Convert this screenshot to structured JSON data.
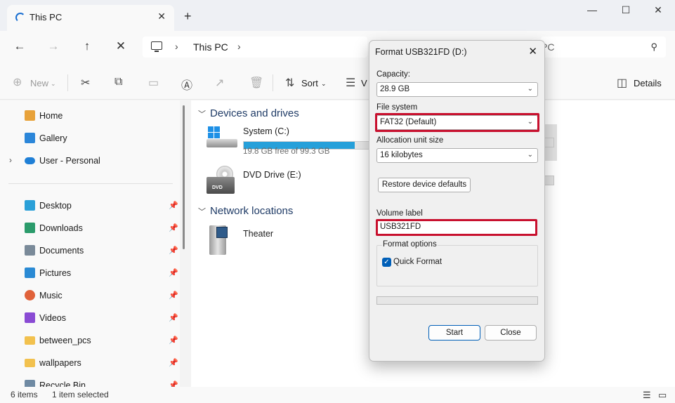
{
  "window": {
    "tab_title": "This PC",
    "new_tab": "+",
    "controls": {
      "minimize": "—",
      "maximize": "☐",
      "close": "✕"
    }
  },
  "address_bar": {
    "back": "←",
    "forward": "→",
    "up": "↑",
    "stop": "✕",
    "separator": "›",
    "crumb": "This PC",
    "search_placeholder": "PC",
    "search_icon": "search-icon"
  },
  "command_bar": {
    "new_label": "New",
    "sort_label": "Sort",
    "view_label": "V",
    "details_label": "Details",
    "icons": [
      "add-icon",
      "cut-icon",
      "copy-icon",
      "paste-icon",
      "rename-icon",
      "share-icon",
      "delete-icon",
      "sort-icon",
      "view-icon",
      "details-icon"
    ]
  },
  "nav": {
    "items_top": [
      {
        "label": "Home",
        "icon": "home-icon",
        "color": "#e8a23a"
      },
      {
        "label": "Gallery",
        "icon": "gallery-icon",
        "color": "#2b86d9"
      },
      {
        "label": "User - Personal",
        "icon": "onedrive-icon",
        "color": "#1f7fd6"
      }
    ],
    "items_pinned": [
      {
        "label": "Desktop",
        "icon": "desktop-icon",
        "color": "#2aa0d8"
      },
      {
        "label": "Downloads",
        "icon": "download-icon",
        "color": "#2b9b6b"
      },
      {
        "label": "Documents",
        "icon": "documents-icon",
        "color": "#7a8a99"
      },
      {
        "label": "Pictures",
        "icon": "pictures-icon",
        "color": "#2a8ad4"
      },
      {
        "label": "Music",
        "icon": "music-icon",
        "color": "#e0623a"
      },
      {
        "label": "Videos",
        "icon": "videos-icon",
        "color": "#8a4bd4"
      },
      {
        "label": "between_pcs",
        "icon": "folder-icon",
        "color": "#f2c14e"
      },
      {
        "label": "wallpapers",
        "icon": "folder-icon",
        "color": "#f2c14e"
      },
      {
        "label": "Recycle Bin",
        "icon": "recycle-bin-icon",
        "color": "#6f8aa3"
      }
    ],
    "pin_glyph": "📌"
  },
  "content": {
    "group_devices": "Devices and drives",
    "group_network": "Network locations",
    "drives": [
      {
        "name": "System (C:)",
        "free": "19.8 GB free of 99.3 GB",
        "used_fraction": 0.8
      },
      {
        "name": "DVD Drive (E:)",
        "badge": "DVD"
      }
    ],
    "network": [
      {
        "name": "Theater"
      }
    ]
  },
  "status_bar": {
    "items": "6 items",
    "selected": "1 item selected"
  },
  "dialog": {
    "title": "Format USB321FD (D:)",
    "capacity_label": "Capacity:",
    "capacity_value": "28.9 GB",
    "fs_label": "File system",
    "fs_value": "FAT32 (Default)",
    "alloc_label": "Allocation unit size",
    "alloc_value": "16 kilobytes",
    "restore_label": "Restore device defaults",
    "volume_label": "Volume label",
    "volume_value": "USB321FD",
    "options_label": "Format options",
    "quick_format_label": "Quick Format",
    "quick_format_checked": true,
    "progress": 0,
    "start_label": "Start",
    "close_label": "Close",
    "highlight_color": "#c8102e"
  }
}
